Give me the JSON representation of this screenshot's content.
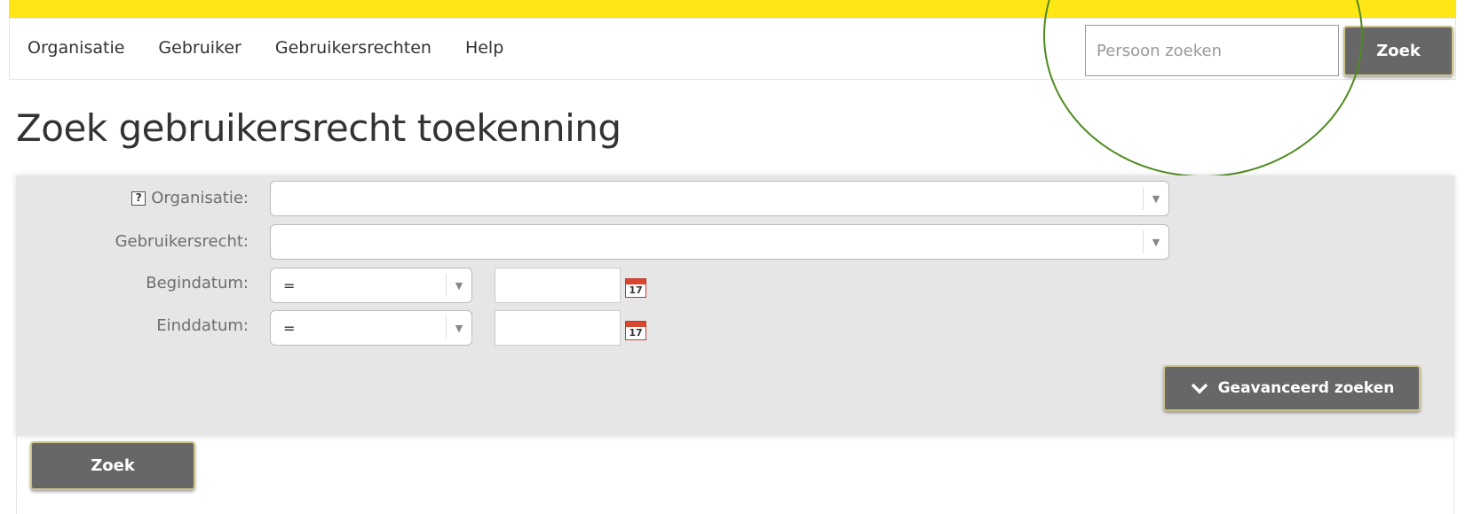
{
  "nav": {
    "items": [
      {
        "label": "Organisatie"
      },
      {
        "label": "Gebruiker"
      },
      {
        "label": "Gebruikersrechten"
      },
      {
        "label": "Help"
      }
    ],
    "search_placeholder": "Persoon zoeken",
    "search_button": "Zoek"
  },
  "page": {
    "title": "Zoek gebruikersrecht toekenning"
  },
  "form": {
    "organisatie_label": "Organisatie:",
    "organisatie_value": "",
    "gebruikersrecht_label": "Gebruikersrecht:",
    "gebruikersrecht_value": "",
    "begindatum_label": "Begindatum:",
    "begindatum_operator": "=",
    "begindatum_value": "",
    "einddatum_label": "Einddatum:",
    "einddatum_operator": "=",
    "einddatum_value": "",
    "calendar_day": "17",
    "advanced_button": "Geavanceerd zoeken",
    "submit_button": "Zoek"
  },
  "colors": {
    "brand_yellow": "#ffe615",
    "button_gray": "#676767",
    "panel_gray": "#e6e6e6",
    "highlight_green": "#4e8a1e"
  }
}
